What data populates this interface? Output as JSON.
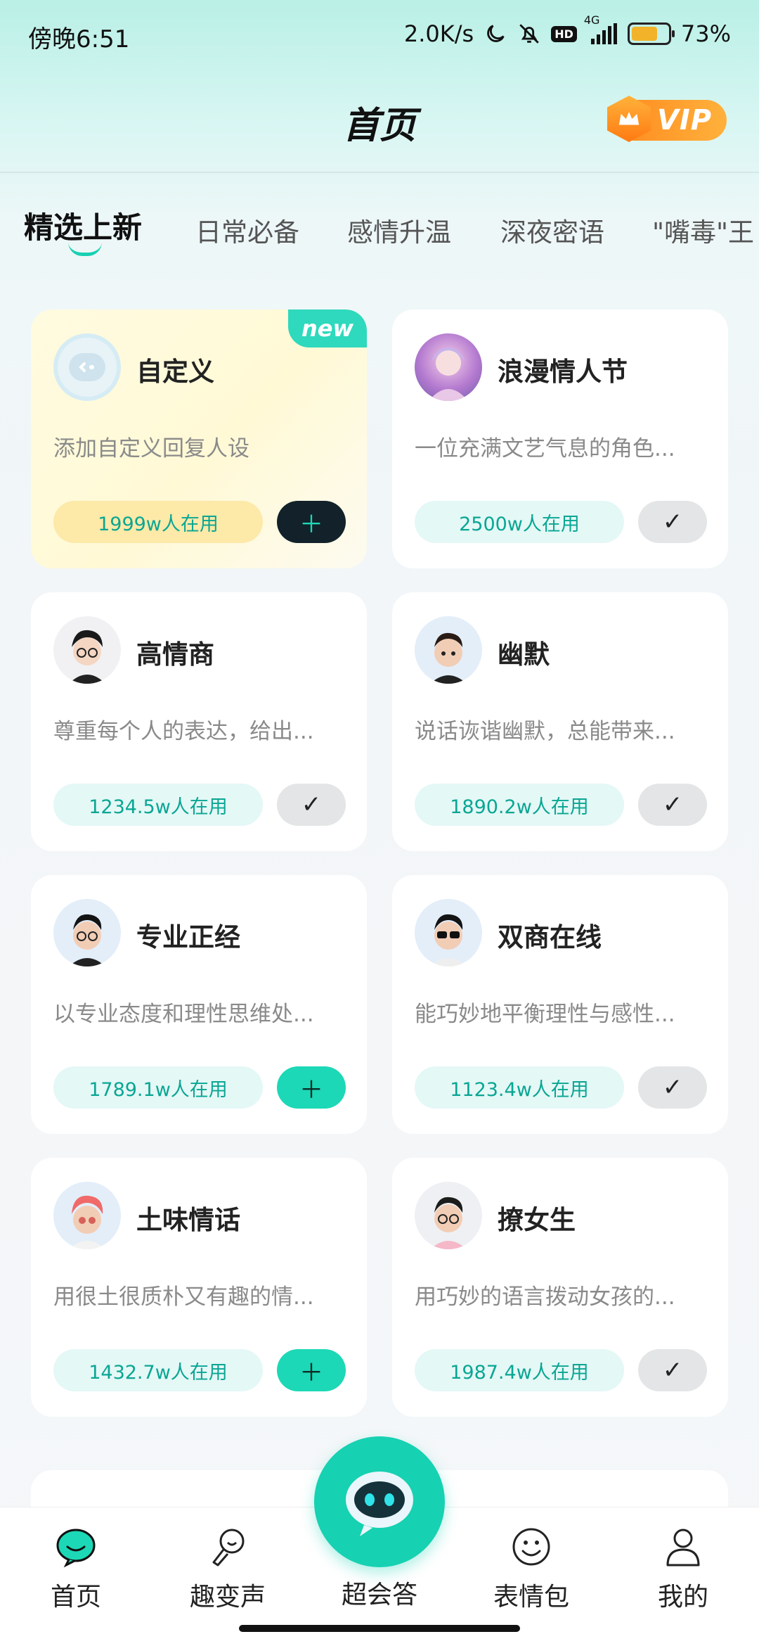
{
  "status_bar": {
    "time": "傍晚6:51",
    "network_speed": "2.0K/s",
    "network_type": "4G",
    "hd_label": "HD",
    "battery_percent": "73%",
    "battery_level": 0.73
  },
  "header": {
    "title": "首页",
    "vip_label": "VIP"
  },
  "tabs": [
    {
      "label": "精选上新",
      "active": true
    },
    {
      "label": "日常必备",
      "active": false
    },
    {
      "label": "感情升温",
      "active": false
    },
    {
      "label": "深夜密语",
      "active": false
    },
    {
      "label": "\"嘴毒\"王",
      "active": false
    }
  ],
  "cards": [
    {
      "title": "自定义",
      "desc": "添加自定义回复人设",
      "usage": "1999w人在用",
      "state": "add-dark",
      "tag": "new"
    },
    {
      "title": "浪漫情人节",
      "desc": "一位充满文艺气息的角色...",
      "usage": "2500w人在用",
      "state": "added"
    },
    {
      "title": "高情商",
      "desc": "尊重每个人的表达，给出...",
      "usage": "1234.5w人在用",
      "state": "added"
    },
    {
      "title": "幽默",
      "desc": "说话诙谐幽默，总能带来...",
      "usage": "1890.2w人在用",
      "state": "added"
    },
    {
      "title": "专业正经",
      "desc": "以专业态度和理性思维处...",
      "usage": "1789.1w人在用",
      "state": "add"
    },
    {
      "title": "双商在线",
      "desc": "能巧妙地平衡理性与感性...",
      "usage": "1123.4w人在用",
      "state": "added"
    },
    {
      "title": "土味情话",
      "desc": "用很土很质朴又有趣的情...",
      "usage": "1432.7w人在用",
      "state": "add"
    },
    {
      "title": "撩女生",
      "desc": "用巧妙的语言拨动女孩的...",
      "usage": "1987.4w人在用",
      "state": "added"
    }
  ],
  "nav": {
    "home": "首页",
    "voice": "趣变声",
    "center": "超会答",
    "stickers": "表情包",
    "mine": "我的"
  },
  "colors": {
    "accent": "#16d1b2",
    "pill_bg": "#e4f8f6",
    "pill_text": "#0aa693",
    "vip_orange": "#ff8a1e"
  }
}
